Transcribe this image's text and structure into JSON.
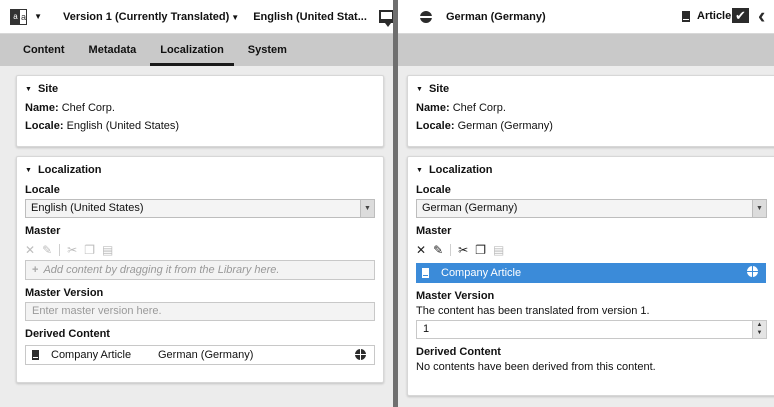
{
  "left": {
    "topbar": {
      "lang_icon": "translate-icon",
      "version": "Version 1 (Currently Translated)",
      "language": "English (United Stat...",
      "comment_icon": "comment-icon"
    },
    "tabs": [
      {
        "label": "Content"
      },
      {
        "label": "Metadata"
      },
      {
        "label": "Localization",
        "active": true
      },
      {
        "label": "System"
      }
    ],
    "site": {
      "title": "Site",
      "name_label": "Name:",
      "name_value": "Chef Corp.",
      "locale_label": "Locale:",
      "locale_value": "English (United States)"
    },
    "localization": {
      "title": "Localization",
      "locale_label": "Locale",
      "locale_value": "English (United States)",
      "master_label": "Master",
      "dropzone_placeholder": "Add content by dragging it from the Library here.",
      "master_version_label": "Master Version",
      "master_version_placeholder": "Enter master version here.",
      "derived_label": "Derived Content",
      "derived_name": "Company Article",
      "derived_locale": "German (Germany)"
    }
  },
  "right": {
    "topbar": {
      "locale": "German (Germany)",
      "doc_type": "Article",
      "approve_icon": "checkmark-icon",
      "back_icon": "chevron-left-icon"
    },
    "site": {
      "title": "Site",
      "name_label": "Name:",
      "name_value": "Chef Corp.",
      "locale_label": "Locale:",
      "locale_value": "German (Germany)"
    },
    "localization": {
      "title": "Localization",
      "locale_label": "Locale",
      "locale_value": "German (Germany)",
      "master_label": "Master",
      "master_item": "Company Article",
      "master_version_label": "Master Version",
      "master_version_text": "The content has been translated from version 1.",
      "master_version_value": "1",
      "derived_label": "Derived Content",
      "derived_text": "No contents have been derived from this content."
    }
  },
  "colors": {
    "selection": "#3b8bd9",
    "tabbar": "#c9c9c9",
    "background": "#ececec",
    "divider": "#6f6f6f"
  }
}
